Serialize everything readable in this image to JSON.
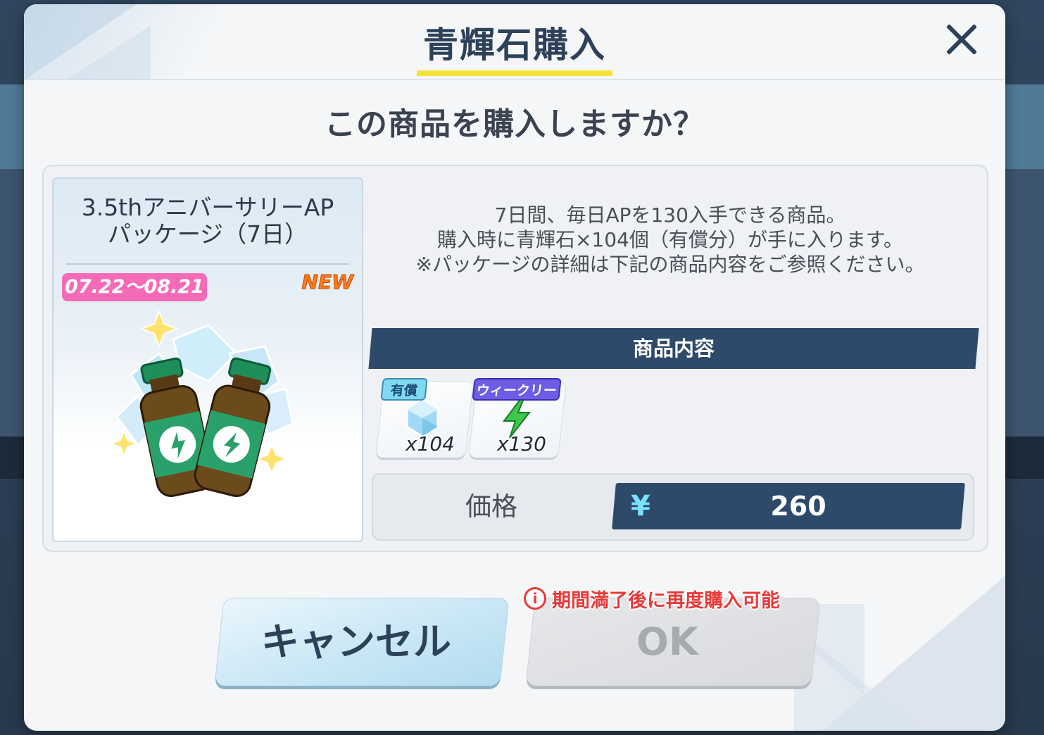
{
  "dialog": {
    "title": "青輝石購入",
    "question": "この商品を購入しますか？"
  },
  "product": {
    "name_line1": "3.5thアニバーサリーAP",
    "name_line2": "パッケージ（7日）",
    "date_range": "07.22～08.21",
    "badge": "NEW",
    "image_icon": "energy-drink-bottles-with-crystals"
  },
  "description": {
    "line1": "7日間、毎日APを130入手できる商品。",
    "line2": "購入時に青輝石×104個（有償分）が手に入ります。",
    "line3": "※パッケージの詳細は下記の商品内容をご参照ください。"
  },
  "contents": {
    "header": "商品内容",
    "items": [
      {
        "tag": "有償",
        "quantity": "x104",
        "icon": "blue-crystal-icon"
      },
      {
        "tag": "ウィークリー",
        "quantity": "x130",
        "icon": "green-lightning-icon"
      }
    ]
  },
  "price": {
    "label": "価格",
    "currency": "¥",
    "value": "260"
  },
  "buttons": {
    "cancel": "キャンセル",
    "ok": "OK"
  },
  "notice": {
    "icon": "i",
    "text": "期間満了後に再度購入可能"
  },
  "colors": {
    "title": "#2d4159",
    "accent_yellow": "#f4e23a",
    "navy_panel": "#2d4a6b",
    "date_pink": "#f56bb8",
    "notice_red": "#e83a3a"
  }
}
